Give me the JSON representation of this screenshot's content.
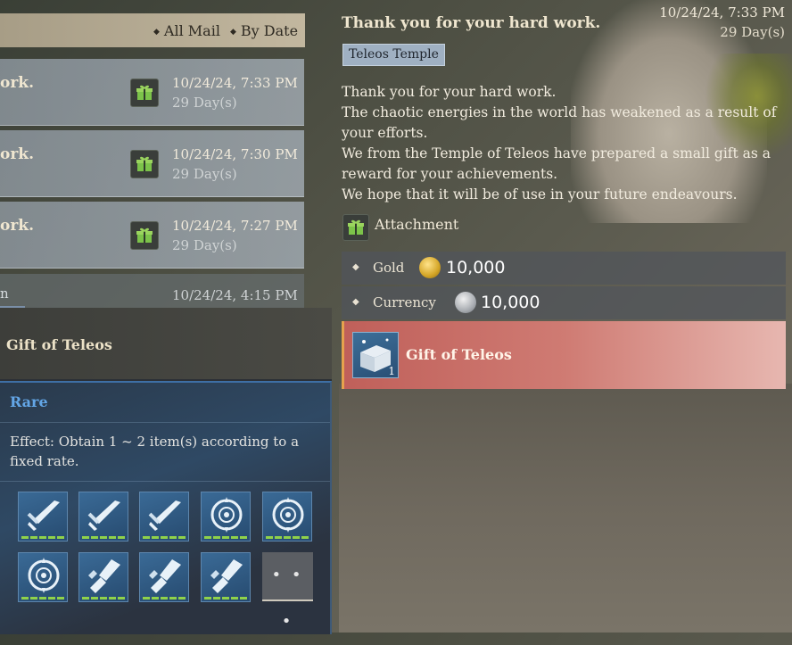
{
  "list": {
    "filters": [
      "All Mail",
      "By Date"
    ],
    "mails": [
      {
        "subject": "ork.",
        "date": "10/24/24, 7:33 PM",
        "days": "29 Day(s)"
      },
      {
        "subject": "ork.",
        "date": "10/24/24, 7:30 PM",
        "days": "29 Day(s)"
      },
      {
        "subject": "ork.",
        "date": "10/24/24, 7:27 PM",
        "days": "29 Day(s)"
      }
    ],
    "partial": {
      "subject": "n",
      "date": "10/24/24, 4:15 PM"
    }
  },
  "tooltip": {
    "title": "Gift of Teleos",
    "rarity": "Rare",
    "effect": "Effect: Obtain 1 ~ 2 item(s) according to a fixed rate.",
    "items": [
      "sword-icon",
      "sword-icon",
      "sword-icon",
      "shield-icon",
      "shield-icon",
      "shield-icon",
      "gauntlet-icon",
      "gauntlet-icon",
      "gauntlet-icon"
    ],
    "more_label": "• • •"
  },
  "detail": {
    "title": "Thank you for your hard work.",
    "date": "10/24/24, 7:33 PM",
    "days": "29 Day(s)",
    "sender": "Teleos Temple",
    "body": [
      "Thank you for your hard work.",
      "The chaotic energies in the world has weakened as a result of",
      "your efforts.",
      "We from the Temple of Teleos have prepared a small gift as a",
      "reward for your achievements.",
      "We hope that it will be of use in your future endeavours."
    ],
    "attachment_label": "Attachment",
    "rewards": [
      {
        "label": "Gold",
        "amount": "10,000",
        "icon": "gold-coin-icon"
      },
      {
        "label": "Currency",
        "amount": "10,000",
        "icon": "silver-coin-icon"
      }
    ],
    "gift": {
      "name": "Gift of Teleos",
      "qty": "1",
      "icon": "treasure-chest-icon"
    }
  },
  "colors": {
    "accent_blue": "#63a6e6",
    "pip_green": "#8fd24a",
    "gift_highlight": "#c0605a"
  }
}
